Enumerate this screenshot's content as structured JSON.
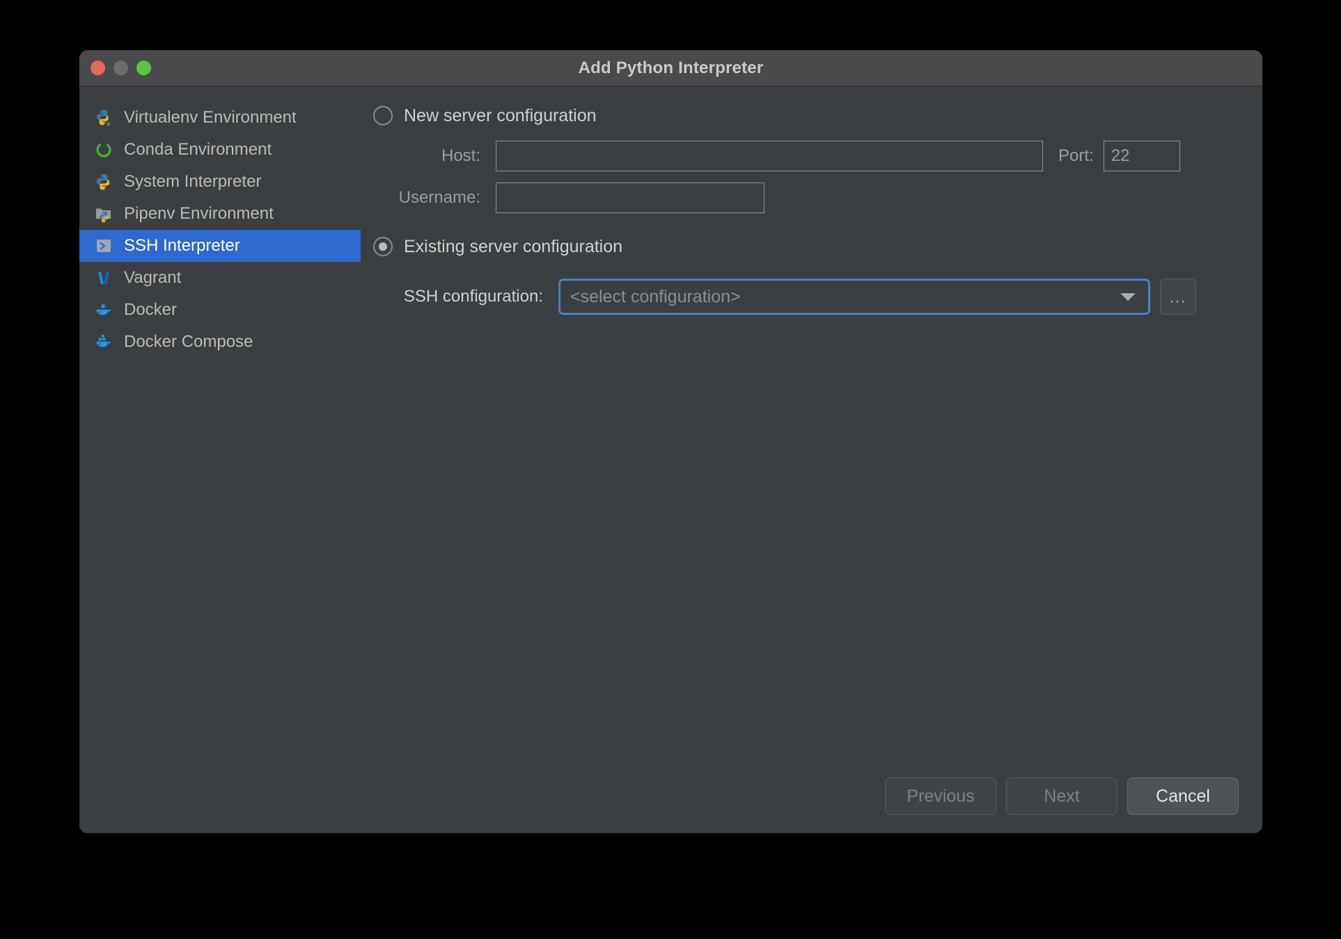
{
  "window": {
    "title": "Add Python Interpreter",
    "traffic_lights": [
      {
        "name": "close",
        "color": "#e8665c"
      },
      {
        "name": "minimize",
        "color": "#6c6c6e"
      },
      {
        "name": "zoom",
        "color": "#59c840"
      }
    ],
    "accent_color": "#2f68ce",
    "focus_border_color": "#4c7fc4",
    "background_color": "#3c3f41",
    "titlebar_color": "#4a4a4c"
  },
  "sidebar": {
    "items": [
      {
        "label": "Virtualenv Environment",
        "icon": "python-virtualenv-icon",
        "selected": false
      },
      {
        "label": "Conda Environment",
        "icon": "conda-icon",
        "selected": false
      },
      {
        "label": "System Interpreter",
        "icon": "python-icon",
        "selected": false
      },
      {
        "label": "Pipenv Environment",
        "icon": "pipenv-folder-icon",
        "selected": false
      },
      {
        "label": "SSH Interpreter",
        "icon": "ssh-terminal-icon",
        "selected": true
      },
      {
        "label": "Vagrant",
        "icon": "vagrant-icon",
        "selected": false
      },
      {
        "label": "Docker",
        "icon": "docker-icon",
        "selected": false
      },
      {
        "label": "Docker Compose",
        "icon": "docker-compose-icon",
        "selected": false
      }
    ]
  },
  "main": {
    "new_server": {
      "radio_label": "New server configuration",
      "selected": false,
      "host_label": "Host:",
      "host_value": "",
      "host_placeholder": "",
      "port_label": "Port:",
      "port_value": "22",
      "username_label": "Username:",
      "username_value": "",
      "username_placeholder": ""
    },
    "existing_server": {
      "radio_label": "Existing server configuration",
      "selected": true,
      "ssh_config_label": "SSH configuration:",
      "ssh_config_value": "<select configuration>",
      "dropdown_icon": "chevron-down-icon",
      "browse_button_label": "...",
      "browse_button_icon": "ellipsis-icon"
    }
  },
  "footer": {
    "previous_label": "Previous",
    "next_label": "Next",
    "cancel_label": "Cancel",
    "previous_enabled": false,
    "next_enabled": false,
    "cancel_enabled": true
  }
}
